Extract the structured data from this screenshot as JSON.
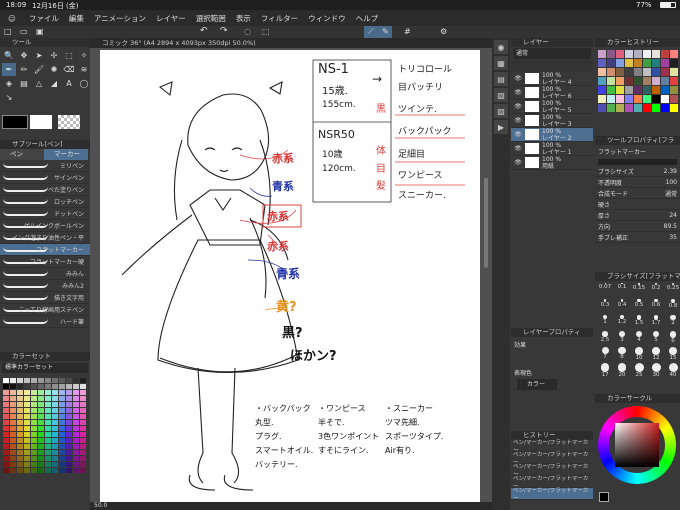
{
  "status": {
    "time": "18:09",
    "date": "12月16日 (金)",
    "battery": "77%"
  },
  "menu": [
    "ファイル",
    "編集",
    "アニメーション",
    "レイヤー",
    "選択範囲",
    "表示",
    "フィルター",
    "ウィンドウ",
    "ヘルプ"
  ],
  "tool_panel": {
    "title": "ツール"
  },
  "subtool_panel": {
    "title": "サブツール[ペン]",
    "tabs": [
      "ペン",
      "マーカー"
    ],
    "brushes": [
      "ミリペン",
      "サインペン",
      "べた塗りペン",
      "ロッチペン",
      "ドットペン",
      "ゲルインクボールペン",
      "インク溜まり油性ペン・平",
      "フラットマーカー",
      "フラットマーカー硬",
      "みみん",
      "みみん2",
      "描き文字用",
      "こってり線画用ステペン",
      "ハード筆"
    ],
    "selected_index": 7
  },
  "color_set": {
    "title": "カラーセット",
    "preset": "標準カラーセット"
  },
  "canvas": {
    "tab": "コミック 36° (A4 2894 x 4093px 350dpi 50.0%)",
    "zoom": "50.0"
  },
  "notes": {
    "ns1": "NS-1",
    "age1": "15歳.",
    "height1": "155cm.",
    "nsr": "NSR50",
    "age2": "10歳",
    "height2": "120cm.",
    "arrow": "→",
    "list": [
      "トリコロール",
      "目パッチリ",
      "ツインテ.",
      "バックパック",
      "足細目",
      "ワンピース",
      "スニーカー."
    ],
    "side": [
      "黒",
      "体",
      "目",
      "髪"
    ],
    "aka1": "赤系",
    "ao1": "青系",
    "aka2": "赤系",
    "aka3": "赤系",
    "ao2": "青系",
    "ki": "黄?",
    "kuro": "黒?",
    "hoka": "ほかン?",
    "bottom1": [
      "・バックパック",
      "丸型.",
      "プラグ.",
      "スマートオイル.",
      "バッテリー."
    ],
    "bottom2": [
      "・ワンピース",
      "半そで.",
      "3色ワンポイント",
      "すそにライン."
    ],
    "bottom3": [
      "・スニーカー",
      "ツマ先細.",
      "スポーツタイプ.",
      "Air有り."
    ]
  },
  "layer_panel": {
    "title": "レイヤー",
    "blend": "通常",
    "layers": [
      {
        "pct": "100 %",
        "mode": "通常",
        "name": "レイヤー 4"
      },
      {
        "pct": "100 %",
        "mode": "通常",
        "name": "レイヤー 6"
      },
      {
        "pct": "100 %",
        "mode": "通常",
        "name": "レイヤー 5"
      },
      {
        "pct": "100 %",
        "mode": "通常",
        "name": "レイヤー 3"
      },
      {
        "pct": "100 %",
        "mode": "通常",
        "name": "レイヤー 2"
      },
      {
        "pct": "100 %",
        "mode": "通常",
        "name": "レイヤー 1"
      },
      {
        "pct": "100 %",
        "mode": "通常",
        "name": "用紙"
      }
    ],
    "selected_index": 4
  },
  "layer_property": {
    "title": "レイヤープロパティ",
    "effect": "効果",
    "expression": "表現色",
    "color": "カラー"
  },
  "history": {
    "title": "ヒストリー",
    "items": [
      "ペン/マーカー/フラットマーカー",
      "ペン/マーカー/フラットマーカー",
      "ペン/マーカー/フラットマーカー",
      "ペン/マーカー/フラットマーカー",
      "ペン/マーカー/フラットマーカー"
    ]
  },
  "color_history": {
    "title": "カラーヒストリー"
  },
  "tool_property": {
    "title": "ツールプロパティ[フラ",
    "brush_name": "フラットマーカー",
    "rows": [
      {
        "label": "ブラシサイズ",
        "value": "2.39"
      },
      {
        "label": "不透明度",
        "value": "100"
      },
      {
        "label": "合成モード",
        "value": "通常"
      },
      {
        "label": "硬さ",
        "value": ""
      },
      {
        "label": "厚さ",
        "value": "24"
      },
      {
        "label": "方向",
        "value": "89.5"
      },
      {
        "label": "手ブレ補正",
        "value": "35"
      }
    ]
  },
  "brush_size": {
    "title": "ブラシサイズ[フラットマ",
    "sizes": [
      "0.07",
      "0.1",
      "0.15",
      "0.2",
      "0.25",
      "0.3",
      "0.4",
      "0.5",
      "0.6",
      "0.8",
      "1",
      "1.2",
      "1.5",
      "1.7",
      "2",
      "2.5",
      "3",
      "4",
      "5",
      "6",
      "7",
      "8",
      "10",
      "12",
      "15",
      "17",
      "20",
      "25",
      "30",
      "40"
    ]
  },
  "color_circle": {
    "title": "カラーサークル"
  }
}
